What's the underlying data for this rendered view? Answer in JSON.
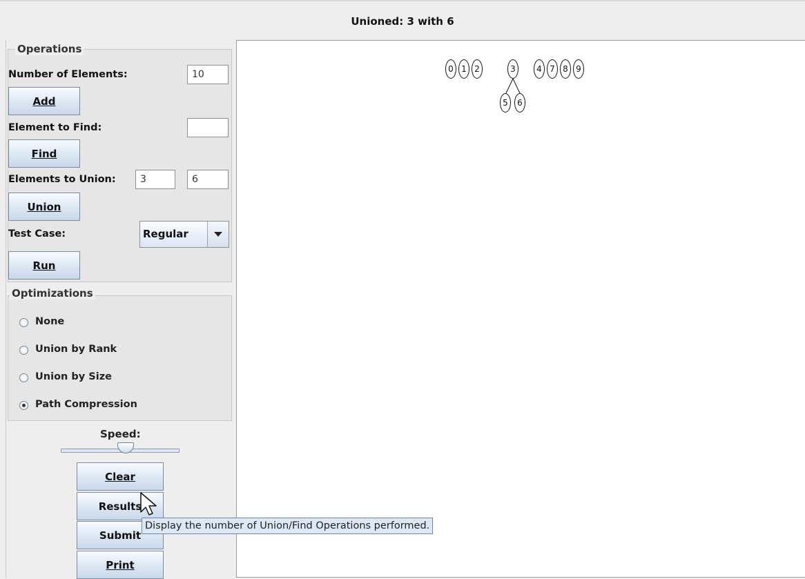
{
  "window": {
    "title": "Unioned: 3 with 6"
  },
  "operations": {
    "legend": "Operations",
    "number_of_elements": {
      "label": "Number of Elements:",
      "value": "10"
    },
    "add_label": "Add",
    "element_to_find": {
      "label": "Element to Find:",
      "value": ""
    },
    "find_label": "Find",
    "elements_to_union": {
      "label": "Elements to Union:",
      "value_a": "3",
      "value_b": "6"
    },
    "union_label": "Union",
    "test_case": {
      "label": "Test Case:",
      "selected": "Regular"
    },
    "run_label": "Run"
  },
  "optimizations": {
    "legend": "Optimizations",
    "options": [
      {
        "label": "None",
        "checked": false
      },
      {
        "label": "Union by Rank",
        "checked": false
      },
      {
        "label": "Union by Size",
        "checked": false
      },
      {
        "label": "Path Compression",
        "checked": true
      }
    ]
  },
  "speed": {
    "label": "Speed:",
    "level": 0.5
  },
  "actions": {
    "clear_label": "Clear",
    "results_label": "Results",
    "submit_label": "Submit",
    "print_label": "Print"
  },
  "tooltip": {
    "text": "Display the number of Union/Find Operations performed."
  },
  "forest": {
    "roots": [
      "0",
      "1",
      "2",
      "3",
      "4",
      "7",
      "8",
      "9"
    ],
    "children_of_3": [
      "5",
      "6"
    ]
  },
  "icons": {
    "cursor": "pointer-cursor-icon",
    "dropdown": "chevron-down-icon"
  }
}
